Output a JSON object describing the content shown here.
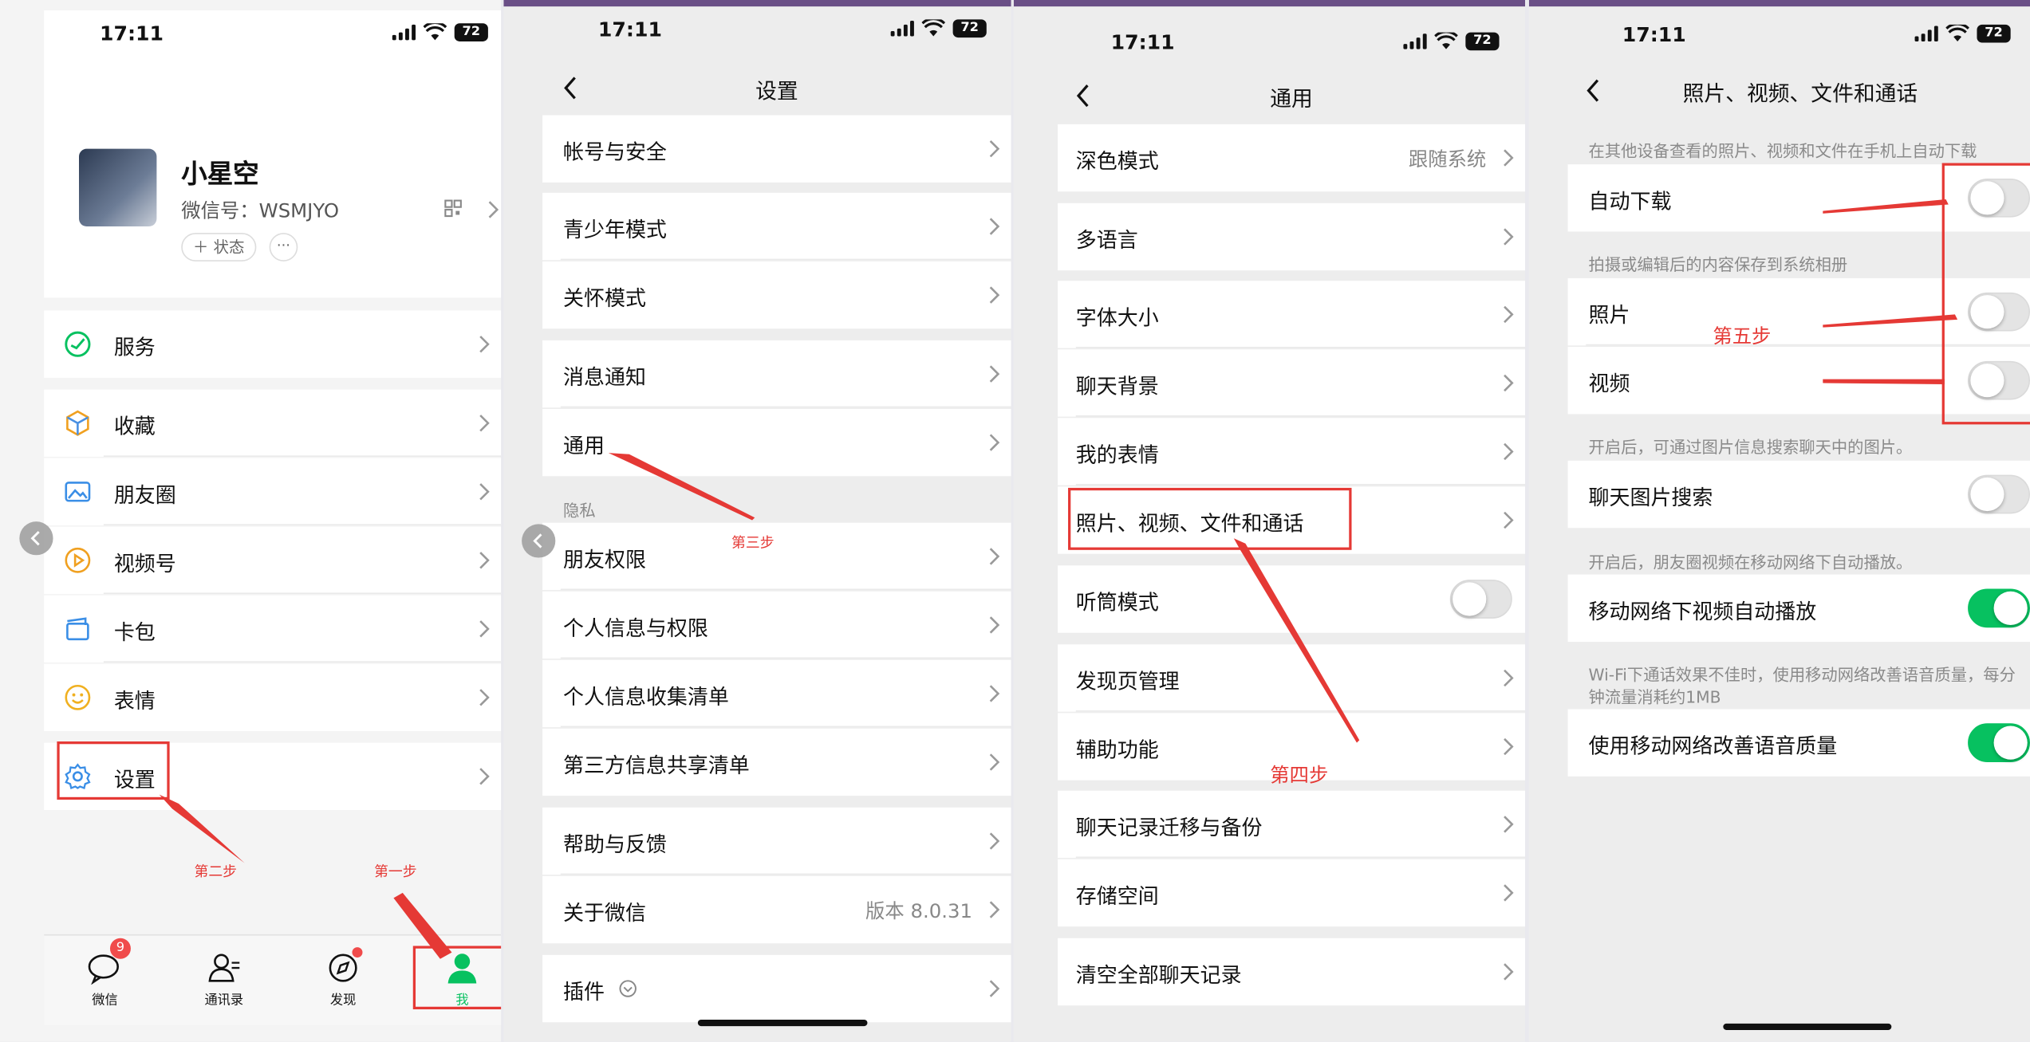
{
  "status": {
    "time": "17:11",
    "battery": "72"
  },
  "profile": {
    "name": "小星空",
    "wechat_id": "微信号：WSMJYO",
    "status_button": "＋ 状态",
    "more_button": "···"
  },
  "me_menu": {
    "services": "服务",
    "favorites": "收藏",
    "moments": "朋友圈",
    "channels": "视频号",
    "cards": "卡包",
    "stickers": "表情",
    "settings": "设置"
  },
  "tabbar": {
    "chats": "微信",
    "chats_badge": "9",
    "contacts": "通讯录",
    "discover": "发现",
    "me": "我"
  },
  "settings": {
    "title": "设置",
    "account_security": "帐号与安全",
    "teen_mode": "青少年模式",
    "care_mode": "关怀模式",
    "notifications": "消息通知",
    "general": "通用",
    "privacy_section": "隐私",
    "friend_permissions": "朋友权限",
    "personal_info": "个人信息与权限",
    "info_collection": "个人信息收集清单",
    "third_party": "第三方信息共享清单",
    "help": "帮助与反馈",
    "about": "关于微信",
    "version": "版本 8.0.31",
    "plugins": "插件"
  },
  "general": {
    "title": "通用",
    "dark_mode": "深色模式",
    "dark_mode_value": "跟随系统",
    "language": "多语言",
    "font_size": "字体大小",
    "chat_background": "聊天背景",
    "my_stickers": "我的表情",
    "media_files_calls": "照片、视频、文件和通话",
    "earpiece_mode": "听筒模式",
    "earpiece_mode_on": false,
    "discover_management": "发现页管理",
    "accessibility": "辅助功能",
    "chat_migration": "聊天记录迁移与备份",
    "storage": "存储空间",
    "clear_chats": "清空全部聊天记录"
  },
  "media": {
    "title": "照片、视频、文件和通话",
    "auto_download_note": "在其他设备查看的照片、视频和文件在手机上自动下载",
    "auto_download": "自动下载",
    "auto_download_on": false,
    "save_note": "拍摄或编辑后的内容保存到系统相册",
    "photos": "照片",
    "photos_on": false,
    "videos": "视频",
    "videos_on": false,
    "search_note": "开启后，可通过图片信息搜索聊天中的图片。",
    "image_search": "聊天图片搜索",
    "image_search_on": false,
    "autoplay_note": "开启后，朋友圈视频在移动网络下自动播放。",
    "autoplay": "移动网络下视频自动播放",
    "autoplay_on": true,
    "voice_note": "Wi-Fi下通话效果不佳时，使用移动网络改善语音质量，每分钟流量消耗约1MB",
    "voice_quality": "使用移动网络改善语音质量",
    "voice_quality_on": true
  },
  "annotations": {
    "step1": "第一步",
    "step2": "第二步",
    "step3": "第三步",
    "step4": "第四步",
    "step5": "第五步"
  },
  "colors": {
    "accent_green": "#07c160",
    "annotation_red": "#e53935",
    "badge_red": "#f04b4b"
  }
}
